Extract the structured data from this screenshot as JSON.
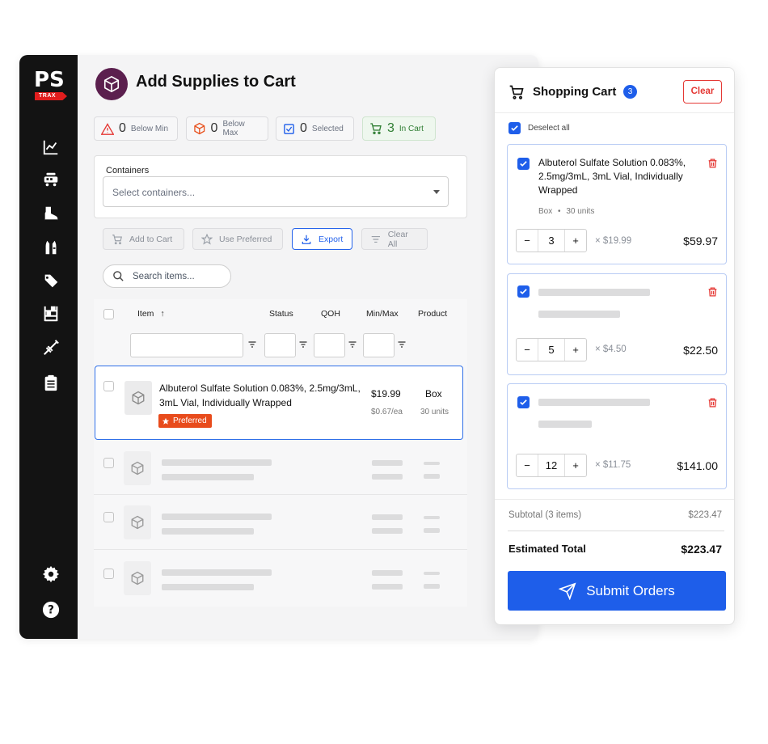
{
  "brand": {
    "logo_text": "PS",
    "logo_tag": "TRAX"
  },
  "page": {
    "title": "Add Supplies to Cart"
  },
  "sidebar": {
    "items": [
      {
        "icon": "chart-line-icon"
      },
      {
        "icon": "cart-truck-icon"
      },
      {
        "icon": "boot-icon"
      },
      {
        "icon": "vest-icon"
      },
      {
        "icon": "tags-icon"
      },
      {
        "icon": "shelves-icon"
      },
      {
        "icon": "syringe-icon"
      },
      {
        "icon": "clipboard-icon"
      }
    ],
    "bottom": [
      {
        "icon": "gear-icon"
      },
      {
        "icon": "help-icon"
      }
    ]
  },
  "stats": [
    {
      "value": "0",
      "label": "Below Min",
      "icon": "warning-icon"
    },
    {
      "value": "0",
      "label": "Below Max",
      "icon": "box-icon"
    },
    {
      "value": "0",
      "label": "Selected",
      "icon": "checkbox-icon"
    },
    {
      "value": "3",
      "label": "In Cart",
      "icon": "cart-icon"
    }
  ],
  "containers": {
    "label": "Containers",
    "placeholder": "Select containers..."
  },
  "toolbar": {
    "add_to_cart": "Add to Cart",
    "use_preferred": "Use Preferred",
    "export": "Export",
    "clear_all": "Clear All"
  },
  "search": {
    "placeholder": "Search items..."
  },
  "table": {
    "columns": [
      "Item",
      "Status",
      "QOH",
      "Min/Max",
      "Product"
    ],
    "sort_indicator": "↑",
    "rows": [
      {
        "name": "Albuterol Sulfate Solution 0.083%, 2.5mg/3mL, 3mL Vial, Individually Wrapped",
        "badge": "Preferred",
        "price": "$19.99",
        "unit_price": "$0.67/ea",
        "product": "Box",
        "product_units": "30 units"
      }
    ]
  },
  "cart": {
    "title": "Shopping Cart",
    "count": "3",
    "clear_label": "Clear",
    "deselect_label": "Deselect all",
    "items": [
      {
        "name": "Albuterol Sulfate Solution 0.083%, 2.5mg/3mL, 3mL Vial, Individually Wrapped",
        "unit": "Box",
        "units": "30 units",
        "meta_sep": "•",
        "qty": "3",
        "unit_price": "× $19.99",
        "line_total": "$59.97"
      },
      {
        "qty": "5",
        "unit_price": "× $4.50",
        "line_total": "$22.50"
      },
      {
        "qty": "12",
        "unit_price": "× $11.75",
        "line_total": "$141.00"
      }
    ],
    "subtotal_label": "Subtotal (3 items)",
    "subtotal_value": "$223.47",
    "estimated_label": "Estimated Total",
    "estimated_value": "$223.47",
    "submit_label": "Submit Orders"
  },
  "colors": {
    "accent": "#1e5eea",
    "danger": "#e53935",
    "preferred": "#e84b1c",
    "sidebar": "#131313",
    "header_icon": "#5b1f4e"
  }
}
